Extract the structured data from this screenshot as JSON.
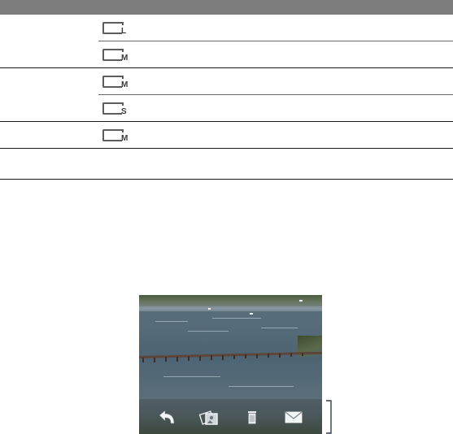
{
  "size_table": {
    "rows": [
      {
        "size_icon": "resolution-large-icon",
        "letter": "L"
      },
      {
        "size_icon": "resolution-medium-icon",
        "letter": "M"
      },
      {
        "size_icon": "resolution-medium-icon",
        "letter": "M"
      },
      {
        "size_icon": "resolution-small-icon",
        "letter": "S"
      },
      {
        "size_icon": "resolution-medium-icon",
        "letter": "M"
      }
    ]
  },
  "review_screen": {
    "toolbar_icons": [
      "back-arrow-icon",
      "album-icon",
      "delete-icon",
      "send-mail-icon"
    ]
  },
  "colors": {
    "header_bar": "#7d7d7d",
    "rule": "#1a1a1a",
    "icon_gray": "#5c5c5c"
  }
}
